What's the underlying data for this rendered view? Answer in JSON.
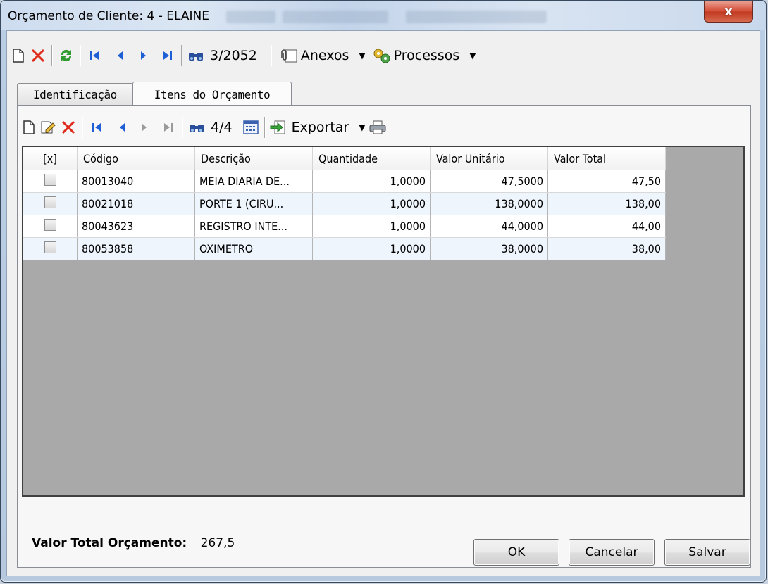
{
  "window": {
    "title": "Orçamento de Cliente: 4 - ELAINE",
    "close_label": "x"
  },
  "main_toolbar": {
    "record_position": "3/2052",
    "anexos_label": "Anexos",
    "processos_label": "Processos"
  },
  "tabs": [
    {
      "label": "Identificação",
      "active": false
    },
    {
      "label": "Itens do Orçamento",
      "active": true
    }
  ],
  "items_toolbar": {
    "record_position": "4/4",
    "exportar_label": "Exportar"
  },
  "grid": {
    "columns": [
      "[x]",
      "Código",
      "Descrição",
      "Quantidade",
      "Valor Unitário",
      "Valor Total"
    ],
    "rows": [
      {
        "checked": false,
        "codigo": "80013040",
        "descricao": "MEIA DIARIA DE...",
        "quantidade": "1,0000",
        "valor_unitario": "47,5000",
        "valor_total": "47,50"
      },
      {
        "checked": false,
        "codigo": "80021018",
        "descricao": "PORTE 1 (CIRU...",
        "quantidade": "1,0000",
        "valor_unitario": "138,0000",
        "valor_total": "138,00"
      },
      {
        "checked": false,
        "codigo": "80043623",
        "descricao": "REGISTRO INTE...",
        "quantidade": "1,0000",
        "valor_unitario": "44,0000",
        "valor_total": "44,00"
      },
      {
        "checked": false,
        "codigo": "80053858",
        "descricao": "OXIMETRO",
        "quantidade": "1,0000",
        "valor_unitario": "38,0000",
        "valor_total": "38,00"
      }
    ]
  },
  "summary": {
    "label": "Valor Total Orçamento:",
    "value": "267,5"
  },
  "buttons": {
    "ok": {
      "accel": "O",
      "rest": "K"
    },
    "cancelar": {
      "accel": "C",
      "rest": "ancelar"
    },
    "salvar": {
      "accel": "S",
      "rest": "alvar"
    }
  },
  "colors": {
    "delete_red": "#e02a1b",
    "nav_blue": "#1f5fd6",
    "refresh_green": "#2f9a2f",
    "grid_background": "#a9a9a9",
    "alt_row": "#eef5fd",
    "close_red": "#c23a22"
  },
  "icons": {
    "new": "new-document-icon",
    "delete": "delete-icon",
    "refresh": "refresh-icon",
    "first": "first-record-icon",
    "prev": "previous-record-icon",
    "next": "next-record-icon",
    "last": "last-record-icon",
    "find": "binoculars-icon",
    "attach": "paperclip-icon",
    "process": "gears-icon",
    "edit": "edit-icon",
    "columns": "columns-grid-icon",
    "export": "export-arrow-icon",
    "print": "printer-icon"
  }
}
